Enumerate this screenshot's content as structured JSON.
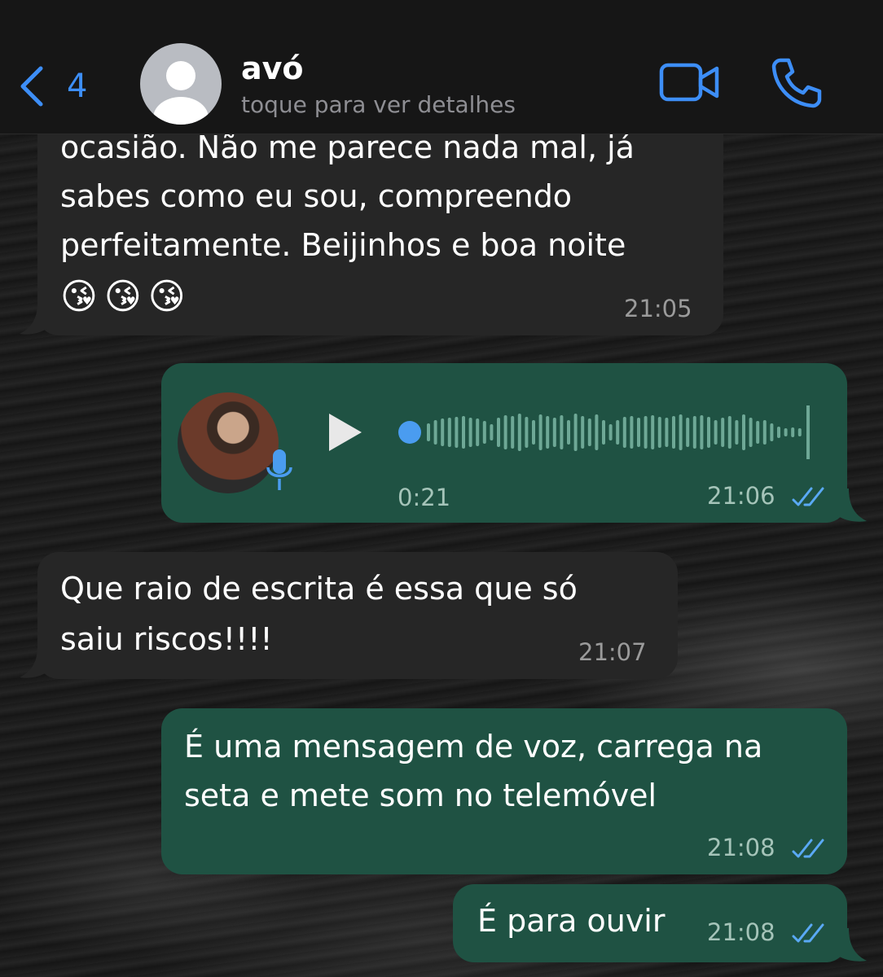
{
  "header": {
    "back_count": "4",
    "contact_name": "avó",
    "contact_subtitle": "toque para ver detalhes"
  },
  "messages": [
    {
      "direction": "in",
      "lines": [
        "ocasião. Não me parece nada mal, já",
        "sabes como eu sou, compreendo",
        "perfeitamente. Beijinhos e boa noite"
      ],
      "emoji": "😘😘😘",
      "time": "21:05"
    },
    {
      "direction": "out",
      "type": "voice",
      "duration": "0:21",
      "time": "21:06",
      "status": "read"
    },
    {
      "direction": "in",
      "lines": [
        "Que raio de escrita é essa que só",
        "saiu riscos!!!!"
      ],
      "time": "21:07"
    },
    {
      "direction": "out",
      "lines": [
        "É uma mensagem de voz, carrega na",
        "seta e mete som no telemóvel"
      ],
      "time": "21:08",
      "status": "read"
    },
    {
      "direction": "out",
      "lines": [
        "É para ouvir"
      ],
      "time": "21:08",
      "status": "read"
    }
  ],
  "colors": {
    "accent": "#3d8ef7",
    "incoming_bubble": "#262626",
    "outgoing_bubble": "#1f5243",
    "read_ticks": "#5aa9f5"
  }
}
